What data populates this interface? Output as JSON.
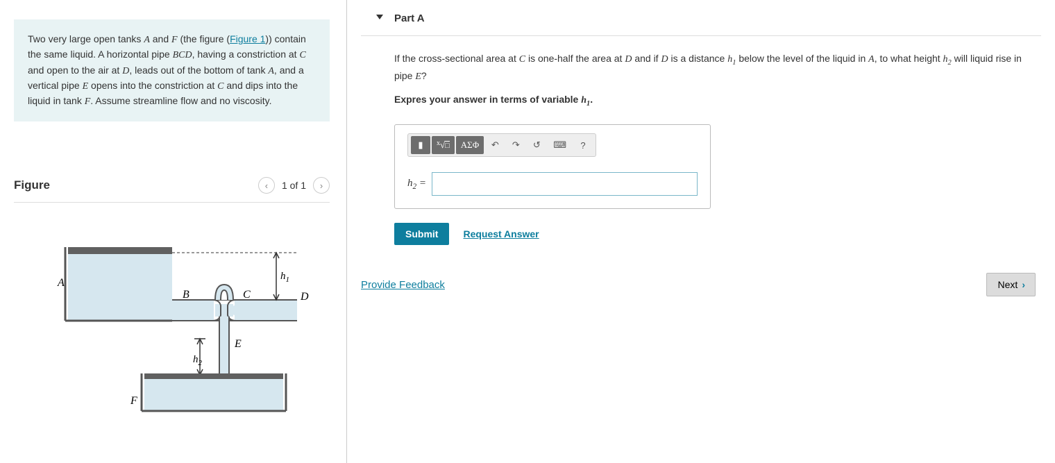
{
  "problem": {
    "text": "Two very large open tanks A and F (the figure (Figure 1)) contain the same liquid. A horizontal pipe BCD, having a constriction at C and open to the air at D, leads out of the bottom of tank A, and a vertical pipe E opens into the constriction at C and dips into the liquid in tank F. Assume streamline flow and no viscosity.",
    "figure_link": "Figure 1"
  },
  "figure": {
    "title": "Figure",
    "nav_text": "1 of 1",
    "labels": {
      "A": "A",
      "B": "B",
      "C": "C",
      "D": "D",
      "E": "E",
      "F": "F",
      "h1": "h₁",
      "h2": "h₂"
    }
  },
  "part": {
    "title": "Part A",
    "question": "If the cross-sectional area at C is one-half the area at D and if D is a distance h₁ below the level of the liquid in A, to what height h₂ will liquid rise in pipe E?",
    "instruction": "Expres your answer in terms of variable h₁.",
    "answer_label": "h₂ =",
    "toolbar": {
      "templates_icon": "▮",
      "sqrt_icon": "√□",
      "greek_icon": "ΑΣΦ",
      "undo_icon": "↶",
      "redo_icon": "↷",
      "reset_icon": "↺",
      "keyboard_icon": "⌨",
      "help_icon": "?"
    },
    "submit_label": "Submit",
    "request_answer_label": "Request Answer"
  },
  "footer": {
    "feedback_label": "Provide Feedback",
    "next_label": "Next"
  }
}
